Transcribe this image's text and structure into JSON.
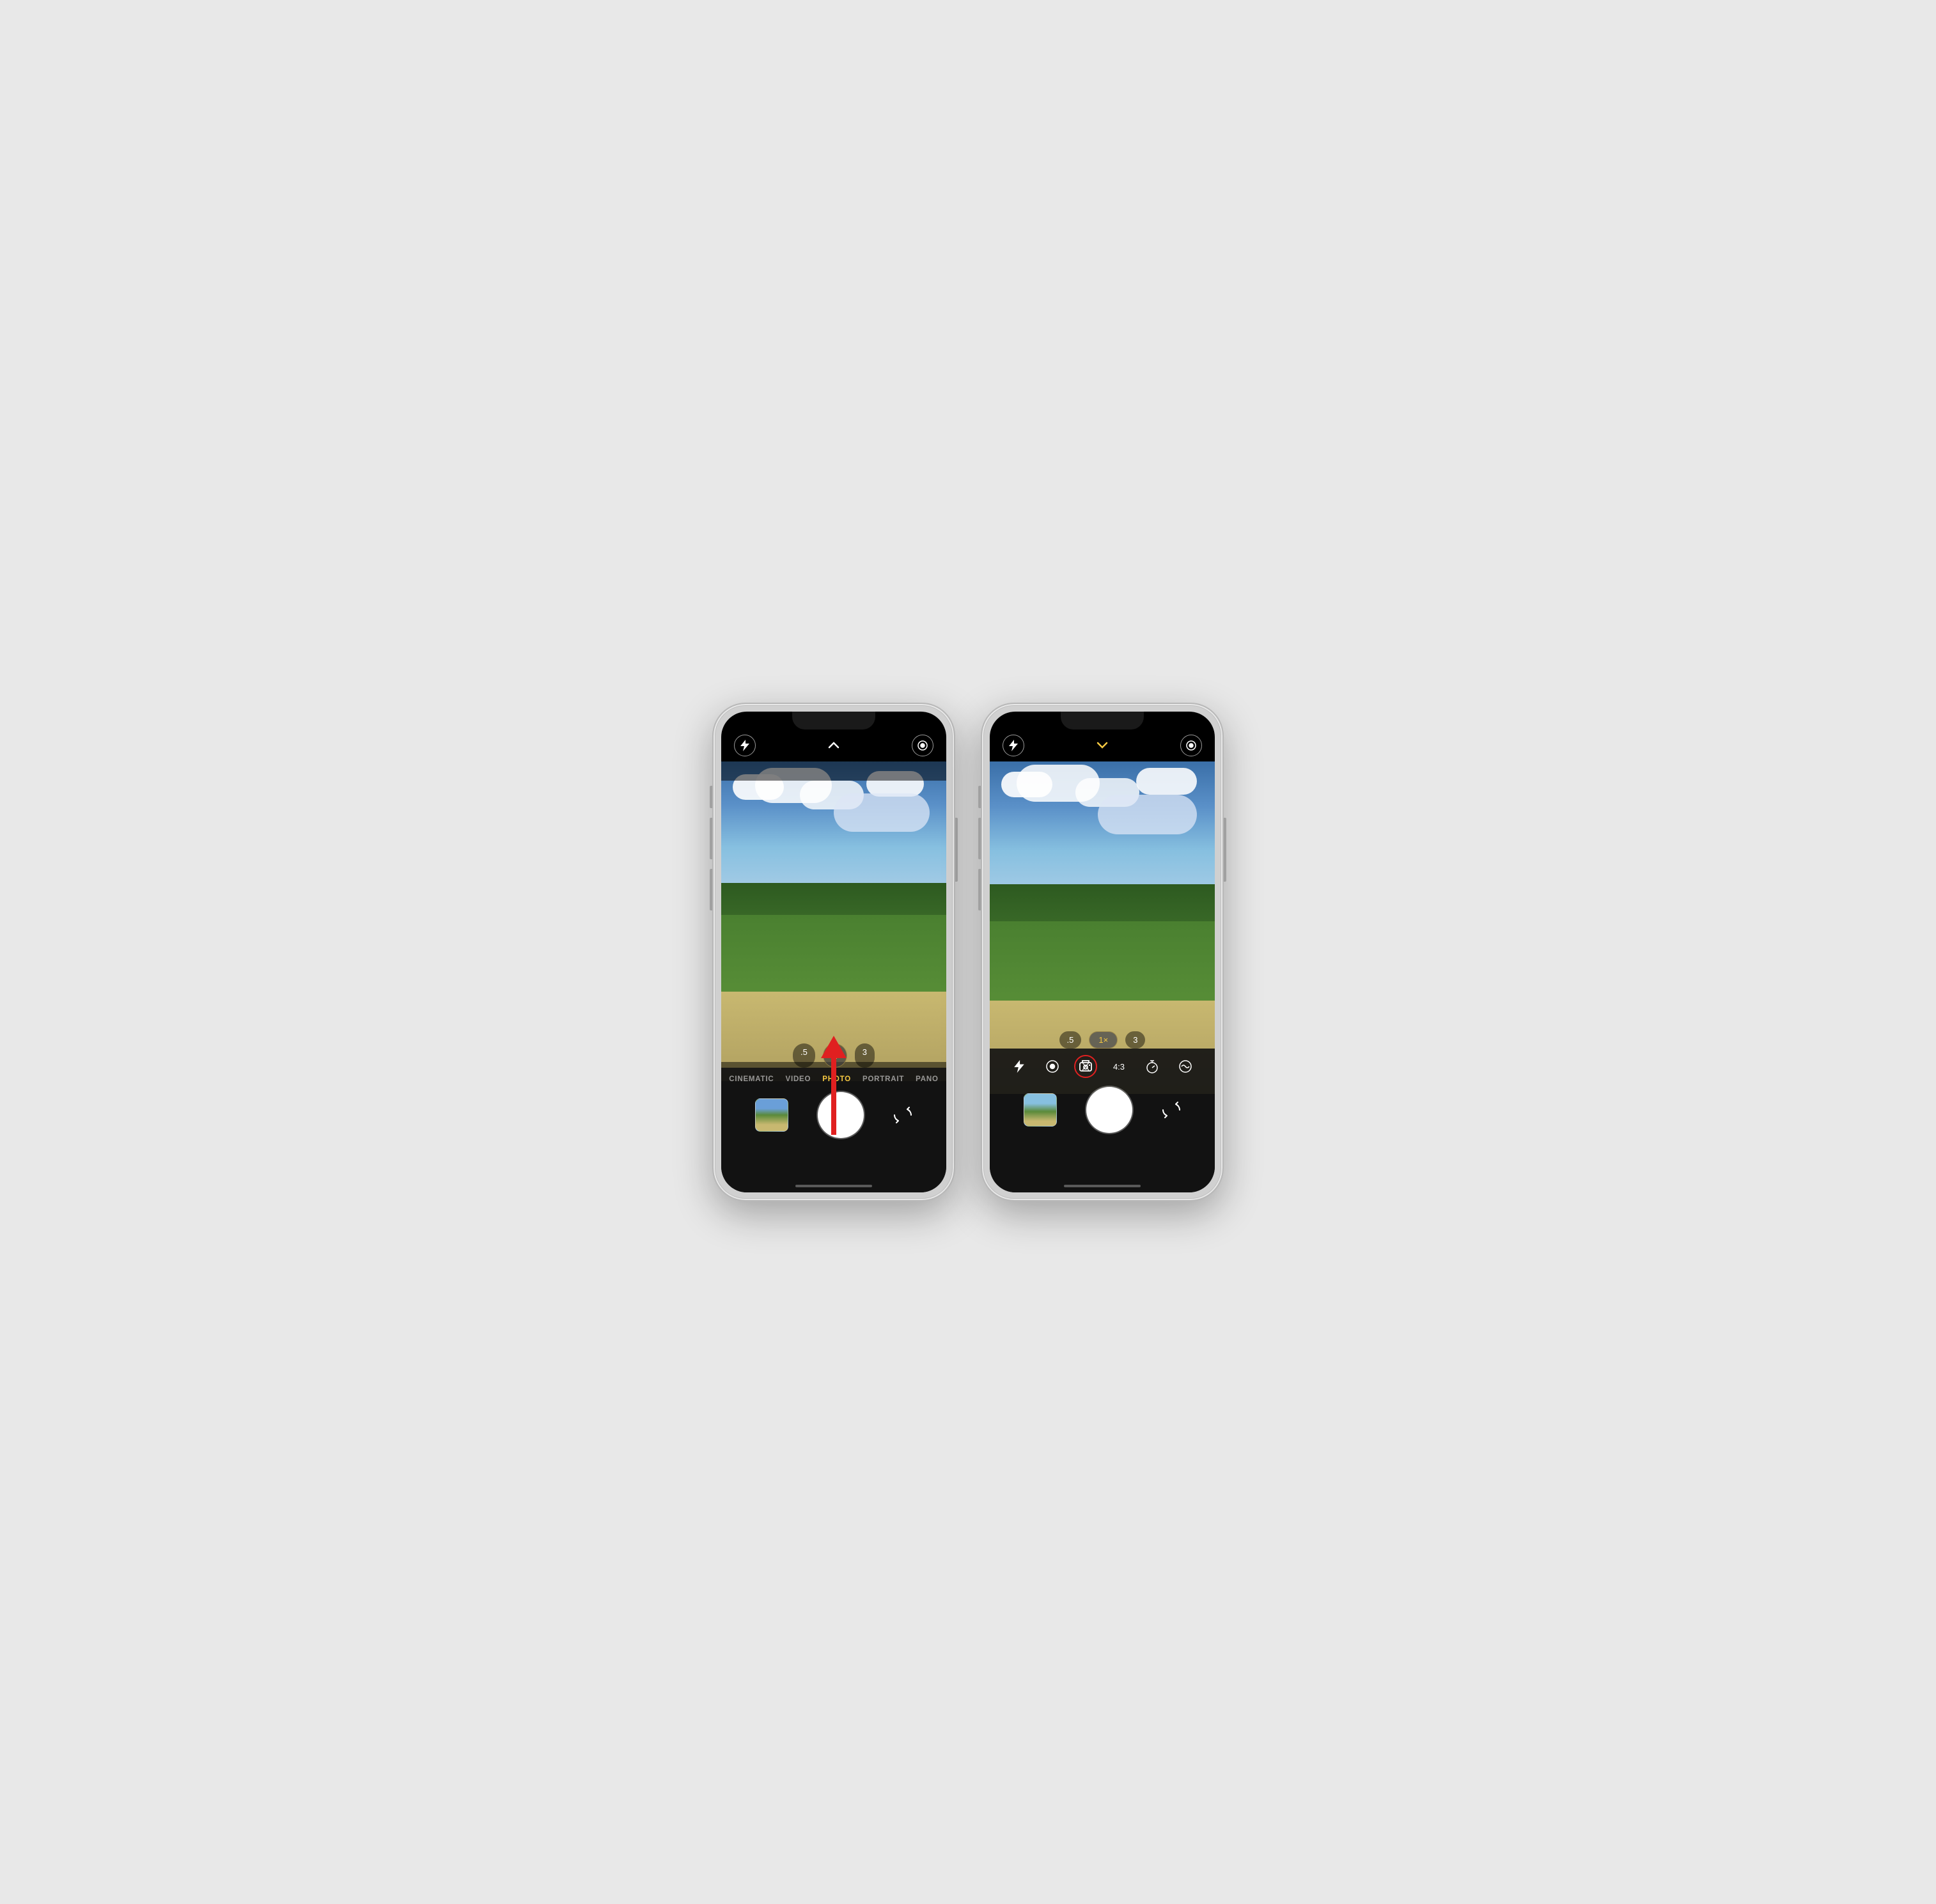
{
  "phone1": {
    "top": {
      "flash_label": "⚡",
      "center_label": "^",
      "center_type": "up_arrow",
      "settings_label": "◎"
    },
    "zoom": {
      "options": [
        ".5",
        "1",
        "3"
      ],
      "active": "1"
    },
    "modes": {
      "items": [
        "CINEMATIC",
        "VIDEO",
        "PHOTO",
        "PORTRAIT",
        "PANO"
      ],
      "active": "PHOTO"
    },
    "arrow": {
      "label": "swipe_up_arrow"
    },
    "shutter": {
      "flip_label": "↺"
    }
  },
  "phone2": {
    "top": {
      "flash_label": "⚡",
      "center_label": "v",
      "center_type": "down_arrow",
      "center_color": "yellow",
      "settings_label": "◎"
    },
    "zoom": {
      "options": [
        ".5",
        "1×",
        "3"
      ],
      "active": "1×"
    },
    "controls": {
      "flash": "⚡",
      "live": "◎",
      "flip_camera": "⇄",
      "aspect": "4:3",
      "timer": "⊕",
      "filters": "↺"
    },
    "shutter": {
      "flip_label": "↺"
    }
  }
}
